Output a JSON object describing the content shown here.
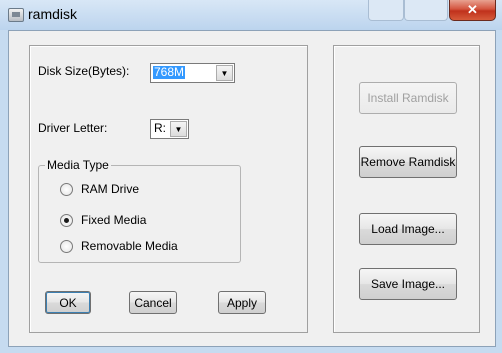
{
  "window": {
    "title": "ramdisk",
    "close_glyph": "✕"
  },
  "left_panel": {
    "disk_size_label": "Disk Size(Bytes):",
    "disk_size_value": "768M",
    "driver_letter_label": "Driver Letter:",
    "driver_letter_value": "R:",
    "media_type": {
      "title": "Media Type",
      "options": [
        {
          "label": "RAM Drive",
          "checked": false
        },
        {
          "label": "Fixed Media",
          "checked": true
        },
        {
          "label": "Removable Media",
          "checked": false
        }
      ]
    },
    "buttons": {
      "ok": "OK",
      "cancel": "Cancel",
      "apply": "Apply"
    }
  },
  "right_panel": {
    "install": "Install Ramdisk",
    "remove": "Remove Ramdisk",
    "load": "Load Image...",
    "save": "Save Image..."
  },
  "icons": {
    "dropdown": "chevron-down-icon",
    "close": "close-icon",
    "app": "app-icon"
  }
}
